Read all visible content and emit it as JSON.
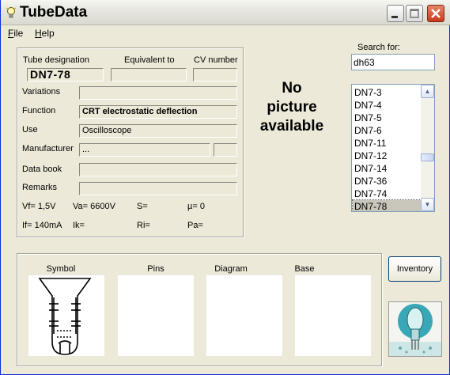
{
  "window": {
    "title": "TubeData"
  },
  "menu": [
    {
      "label": "File",
      "key": "F",
      "rest": "ile"
    },
    {
      "label": "Help",
      "key": "H",
      "rest": "elp"
    }
  ],
  "info": {
    "designation_label": "Tube designation",
    "equivalent_label": "Equivalent to",
    "cv_label": "CV number",
    "designation": "DN7-78",
    "equivalent": "",
    "cv": "",
    "variations_label": "Variations",
    "variations": "",
    "function_label": "Function",
    "function": "CRT electrostatic deflection",
    "use_label": "Use",
    "use": "Oscilloscope",
    "manufacturer_label": "Manufacturer",
    "manufacturer": "...",
    "manufacturer_code": "",
    "databook_label": "Data book",
    "databook": "",
    "remarks_label": "Remarks",
    "remarks": "",
    "vf": "Vf= 1,5V",
    "va": "Va= 6600V",
    "s": "S=",
    "mu": "µ=   0",
    "if": "If= 140mA",
    "ik": "Ik=",
    "ri": "Ri=",
    "pa": "Pa="
  },
  "no_picture": [
    "No",
    "picture",
    "available"
  ],
  "search": {
    "label": "Search for:",
    "value": "dh63"
  },
  "list": [
    "DN7-3",
    "DN7-4",
    "DN7-5",
    "DN7-6",
    "DN7-11",
    "DN7-12",
    "DN7-14",
    "DN7-36",
    "DN7-74",
    "DN7-78"
  ],
  "list_selected": "DN7-78",
  "pictures": {
    "symbol": "Symbol",
    "pins": "Pins",
    "diagram": "Diagram",
    "base": "Base"
  },
  "inventory_label": "Inventory",
  "icons": {
    "app": "lightbulb-icon",
    "minimize": "minimize-icon",
    "maximize": "maximize-icon",
    "close": "close-icon",
    "scroll_up": "arrow-up-icon",
    "scroll_down": "arrow-down-icon",
    "logo": "tube-logo-icon"
  }
}
